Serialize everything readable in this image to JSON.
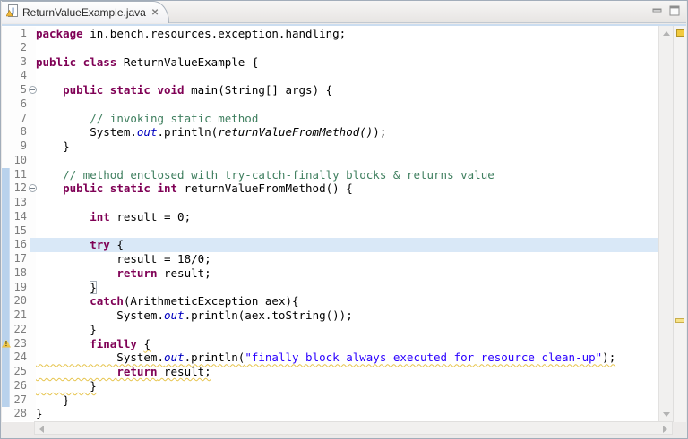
{
  "tab": {
    "label": "ReturnValueExample.java",
    "close_glyph": "✕"
  },
  "icons": {
    "tab_file": "java-file-with-warning-overlay",
    "tab_close": "✕",
    "minimize": "minimize-bar",
    "maximize": "maximize-square",
    "warning": "⚠",
    "fold_collapsed": "⊖",
    "scroll_up": "▲",
    "scroll_down": "▼",
    "scroll_left": "◀",
    "scroll_right": "▶"
  },
  "colors": {
    "keyword": "#7F0055",
    "comment": "#3F7F5F",
    "string": "#2A00FF",
    "field": "#0000C0",
    "current_line_highlight": "#D9E8F7",
    "range_indicator": "#B9D2EC",
    "warning_marker": "#F2CA3E"
  },
  "editor": {
    "language": "java",
    "current_line": 16,
    "warning_line": 23,
    "folding_lines": [
      5,
      12
    ],
    "range_indicator_lines": [
      11,
      27
    ],
    "lines": [
      {
        "n": 1,
        "segments": [
          {
            "text": "package",
            "style": "keyword"
          },
          {
            "text": " in.bench.resources.exception.handling;",
            "style": "plain"
          }
        ]
      },
      {
        "n": 2,
        "segments": []
      },
      {
        "n": 3,
        "segments": [
          {
            "text": "public class",
            "style": "keyword"
          },
          {
            "text": " ReturnValueExample {",
            "style": "plain"
          }
        ]
      },
      {
        "n": 4,
        "segments": []
      },
      {
        "n": 5,
        "fold": true,
        "segments": [
          {
            "text": "    ",
            "style": "plain"
          },
          {
            "text": "public static void",
            "style": "keyword"
          },
          {
            "text": " main(String[] args) {",
            "style": "plain"
          }
        ]
      },
      {
        "n": 6,
        "segments": []
      },
      {
        "n": 7,
        "segments": [
          {
            "text": "        ",
            "style": "plain"
          },
          {
            "text": "// invoking static method",
            "style": "comment"
          }
        ]
      },
      {
        "n": 8,
        "segments": [
          {
            "text": "        System.",
            "style": "plain"
          },
          {
            "text": "out",
            "style": "field"
          },
          {
            "text": ".println(",
            "style": "plain"
          },
          {
            "text": "returnValueFromMethod()",
            "style": "static"
          },
          {
            "text": ");",
            "style": "plain"
          }
        ]
      },
      {
        "n": 9,
        "segments": [
          {
            "text": "    }",
            "style": "plain"
          }
        ]
      },
      {
        "n": 10,
        "segments": []
      },
      {
        "n": 11,
        "range": true,
        "segments": [
          {
            "text": "    ",
            "style": "plain"
          },
          {
            "text": "// method enclosed with try-catch-finally blocks & returns value",
            "style": "comment"
          }
        ]
      },
      {
        "n": 12,
        "range": true,
        "fold": true,
        "segments": [
          {
            "text": "    ",
            "style": "plain"
          },
          {
            "text": "public static int",
            "style": "keyword"
          },
          {
            "text": " returnValueFromMethod() {",
            "style": "plain"
          }
        ]
      },
      {
        "n": 13,
        "range": true,
        "segments": []
      },
      {
        "n": 14,
        "range": true,
        "segments": [
          {
            "text": "        ",
            "style": "plain"
          },
          {
            "text": "int",
            "style": "keyword"
          },
          {
            "text": " result = 0;",
            "style": "plain"
          }
        ]
      },
      {
        "n": 15,
        "range": true,
        "segments": []
      },
      {
        "n": 16,
        "range": true,
        "highlight": true,
        "segments": [
          {
            "text": "        ",
            "style": "plain"
          },
          {
            "text": "try",
            "style": "keyword"
          },
          {
            "text": " {",
            "style": "plain"
          }
        ]
      },
      {
        "n": 17,
        "range": true,
        "segments": [
          {
            "text": "            result = 18/0;",
            "style": "plain"
          }
        ]
      },
      {
        "n": 18,
        "range": true,
        "segments": [
          {
            "text": "            ",
            "style": "plain"
          },
          {
            "text": "return",
            "style": "keyword"
          },
          {
            "text": " result;",
            "style": "plain"
          }
        ]
      },
      {
        "n": 19,
        "range": true,
        "segments": [
          {
            "text": "        ",
            "style": "plain"
          },
          {
            "text": "}",
            "style": "brace"
          }
        ]
      },
      {
        "n": 20,
        "range": true,
        "segments": [
          {
            "text": "        ",
            "style": "plain"
          },
          {
            "text": "catch",
            "style": "keyword"
          },
          {
            "text": "(ArithmeticException aex){",
            "style": "plain"
          }
        ]
      },
      {
        "n": 21,
        "range": true,
        "segments": [
          {
            "text": "            System.",
            "style": "plain"
          },
          {
            "text": "out",
            "style": "field"
          },
          {
            "text": ".println(aex.toString());",
            "style": "plain"
          }
        ]
      },
      {
        "n": 22,
        "range": true,
        "segments": [
          {
            "text": "        }",
            "style": "plain"
          }
        ]
      },
      {
        "n": 23,
        "range": true,
        "warn": true,
        "segments": [
          {
            "text": "        ",
            "style": "plain"
          },
          {
            "text": "finally",
            "style": "keyword"
          },
          {
            "text": " ",
            "style": "plain"
          },
          {
            "text": "{",
            "style": "plain sq"
          }
        ]
      },
      {
        "n": 24,
        "range": true,
        "segments": [
          {
            "text": "            System.",
            "style": "plain sq"
          },
          {
            "text": "out",
            "style": "field sq"
          },
          {
            "text": ".println(",
            "style": "plain sq"
          },
          {
            "text": "\"finally block always executed for resource clean-up\"",
            "style": "string sq"
          },
          {
            "text": ");",
            "style": "plain sq"
          }
        ]
      },
      {
        "n": 25,
        "range": true,
        "segments": [
          {
            "text": "            ",
            "style": "plain sq"
          },
          {
            "text": "return",
            "style": "keyword sq"
          },
          {
            "text": " result;",
            "style": "plain sq"
          }
        ]
      },
      {
        "n": 26,
        "range": true,
        "segments": [
          {
            "text": "        }",
            "style": "plain sq"
          }
        ]
      },
      {
        "n": 27,
        "range": true,
        "segments": [
          {
            "text": "    }",
            "style": "plain"
          }
        ]
      },
      {
        "n": 28,
        "segments": [
          {
            "text": "}",
            "style": "plain"
          }
        ]
      }
    ]
  }
}
